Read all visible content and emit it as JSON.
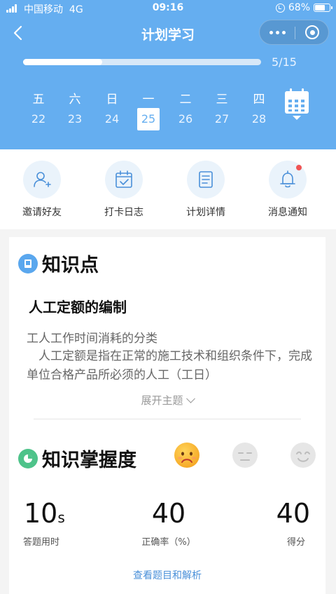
{
  "status_bar": {
    "carrier": "中国移动",
    "network": "4G",
    "time": "09:16",
    "battery": "68%",
    "battery_level": 0.68
  },
  "nav": {
    "title": "计划学习"
  },
  "progress": {
    "text": "5/15",
    "value": 0.333
  },
  "week": {
    "days": [
      {
        "weekday": "五",
        "date": "22",
        "selected": false
      },
      {
        "weekday": "六",
        "date": "23",
        "selected": false
      },
      {
        "weekday": "日",
        "date": "24",
        "selected": false
      },
      {
        "weekday": "一",
        "date": "25",
        "selected": true
      },
      {
        "weekday": "二",
        "date": "26",
        "selected": false
      },
      {
        "weekday": "三",
        "date": "27",
        "selected": false
      },
      {
        "weekday": "四",
        "date": "28",
        "selected": false
      }
    ]
  },
  "quick_actions": [
    {
      "label": "邀请好友",
      "icon": "invite-user-icon"
    },
    {
      "label": "打卡日志",
      "icon": "checkin-calendar-icon"
    },
    {
      "label": "计划详情",
      "icon": "plan-document-icon"
    },
    {
      "label": "消息通知",
      "icon": "bell-icon",
      "has_badge": true
    }
  ],
  "knowledge": {
    "heading": "知识点",
    "topic_title": "人工定额的编制",
    "line1": "工人工作时间消耗的分类",
    "line2": "人工定额是指在正常的施工技术和组织条件下，完成单位合格产品所必须的人工（工日）",
    "expand_label": "展开主题"
  },
  "mastery": {
    "heading": "知识掌握度",
    "faces": [
      "sad-face-icon",
      "neutral-face-icon",
      "smile-face-icon"
    ],
    "selected_face": "sad-face-icon",
    "stats": {
      "time_value": "10",
      "time_unit": "s",
      "time_label": "答题用时",
      "accuracy_value": "40",
      "accuracy_label": "正确率（%）",
      "score_value": "40",
      "score_label": "得分"
    },
    "view_link": "查看题目和解析"
  },
  "colors": {
    "header_blue": "#65aef0",
    "accent_blue": "#4a90d9",
    "badge_red": "#f05454"
  }
}
